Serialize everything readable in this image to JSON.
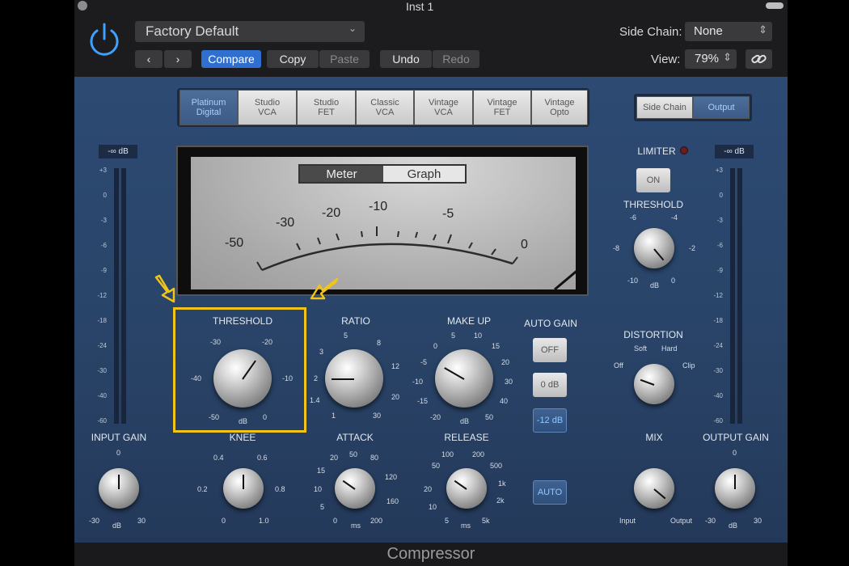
{
  "window": {
    "title": "Inst 1",
    "footer": "Compressor"
  },
  "header": {
    "preset": "Factory Default",
    "compare": "Compare",
    "copy": "Copy",
    "paste": "Paste",
    "undo": "Undo",
    "redo": "Redo",
    "sidechain_label": "Side Chain:",
    "sidechain_value": "None",
    "view_label": "View:",
    "view_value": "79%"
  },
  "models": [
    "Platinum\nDigital",
    "Studio\nVCA",
    "Studio\nFET",
    "Classic\nVCA",
    "Vintage\nVCA",
    "Vintage\nFET",
    "Vintage\nOpto"
  ],
  "right_tabs": {
    "side_chain": "Side Chain",
    "output": "Output"
  },
  "meter": {
    "tab_meter": "Meter",
    "tab_graph": "Graph",
    "scale": [
      "-50",
      "-30",
      "-20",
      "-10",
      "-5",
      "0"
    ]
  },
  "input_meter": {
    "readout": "-∞ dB",
    "scale": [
      "+3",
      "0",
      "-3",
      "-6",
      "-9",
      "-12",
      "-18",
      "-24",
      "-30",
      "-40",
      "-60"
    ]
  },
  "output_meter": {
    "readout": "-∞ dB"
  },
  "knobs": {
    "threshold": {
      "label": "THRESHOLD",
      "scale": [
        "-30",
        "-20",
        "-40",
        "-10",
        "-50",
        "dB",
        "0"
      ]
    },
    "ratio": {
      "label": "RATIO",
      "scale": [
        "5",
        "8",
        "3",
        "12",
        "2",
        "20",
        "1.4",
        "1",
        "30"
      ]
    },
    "makeup": {
      "label": "MAKE UP",
      "scale": [
        "5",
        "10",
        "0",
        "15",
        "-5",
        "20",
        "-10",
        "30",
        "-15",
        "40",
        "-20",
        "dB",
        "50"
      ]
    },
    "knee": {
      "label": "KNEE",
      "scale": [
        "0.4",
        "0.6",
        "0.2",
        "0.8",
        "0",
        "1.0"
      ]
    },
    "attack": {
      "label": "ATTACK",
      "scale": [
        "20",
        "50",
        "80",
        "15",
        "120",
        "10",
        "160",
        "5",
        "0",
        "ms",
        "200"
      ]
    },
    "release": {
      "label": "RELEASE",
      "scale": [
        "100",
        "200",
        "50",
        "500",
        "20",
        "1k",
        "10",
        "2k",
        "5",
        "ms",
        "5k"
      ]
    },
    "input_gain": {
      "label": "INPUT GAIN",
      "scale": [
        "0",
        "-30",
        "dB",
        "30"
      ]
    },
    "output_gain": {
      "label": "OUTPUT GAIN",
      "scale": [
        "0",
        "-30",
        "dB",
        "30"
      ]
    },
    "limiter_threshold": {
      "label": "THRESHOLD",
      "scale": [
        "-6",
        "-4",
        "-8",
        "-2",
        "-10",
        "dB",
        "0"
      ]
    },
    "distortion": {
      "label": "DISTORTION",
      "scale": [
        "Soft",
        "Hard",
        "Off",
        "Clip"
      ]
    },
    "mix": {
      "label": "MIX",
      "scale": [
        "Input",
        "Output"
      ]
    }
  },
  "auto_gain": {
    "label": "AUTO GAIN",
    "off": "OFF",
    "zero": "0 dB",
    "minus12": "-12 dB"
  },
  "release_auto": "AUTO",
  "limiter": {
    "label": "LIMITER",
    "on": "ON"
  },
  "colors": {
    "accent": "#2f6fd0",
    "highlight_box": "#f0c419"
  }
}
